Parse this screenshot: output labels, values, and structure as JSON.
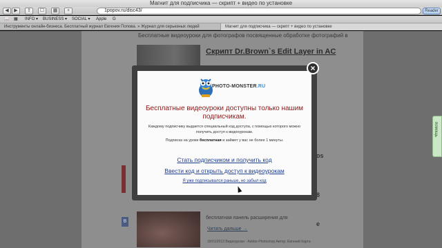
{
  "window": {
    "title": "Магнит для подписчика — скрипт + видео по установке"
  },
  "toolbar": {
    "back_icon": "back-arrow",
    "forward_icon": "forward-arrow",
    "share_icon": "share-icon",
    "bookmarks_icon": "book-icon",
    "history_icon": "grid-icon",
    "add_icon": "plus-icon",
    "url": "1popov.ru/disc43/",
    "reader_label": "Reader"
  },
  "bookmarks": {
    "items": [
      "INFO ▾",
      "BUSINESS ▾",
      "SOCIAL ▾",
      "Apple",
      "G"
    ]
  },
  "tabs": [
    {
      "label": "Инструменты онлайн-бизнеса. Бесплатный журнал Евгения Попова. » Журнал для серьезных людей"
    },
    {
      "label": "Магнит для подписчика — скрипт + видео по установке"
    }
  ],
  "page": {
    "subtitle": "Бесплатные видеоуроки  для фотографов посвященные обработке фотографий в",
    "headline": "Скрипт Dr.Brown`s Edit Layer in AC",
    "snippet": "бесплатная панель расширения для",
    "read_more": "Читать дальше →",
    "meta": "18/01/2013  Видеоуроки · Adobe Photoshop  Автор: Евгений Карта",
    "side_letters": [
      "os",
      "8",
      "e"
    ],
    "left_badge": "B"
  },
  "help_tab": {
    "label": "помощь"
  },
  "modal": {
    "logo_text": "PHOTO-MONSTER",
    "logo_suffix": ".RU",
    "title": "Бесплатные видеоуроки доступны только нашим подписчикам.",
    "description": "Каждому подписчику выдается специальный код доступа, с помощью которого можно получить доступ к видеоурокам.",
    "note_prefix": "Подписка на уроки",
    "note_bold": "бесплатная",
    "note_suffix": "и займет у вас не более 1 минуты.",
    "link_subscribe": "Стать подписчиком и получить код",
    "link_enter_code": "Ввести код и открыть доступ к видеоурокам",
    "link_forgot": "Я уже подписывался раньше, но забыл код",
    "close_label": "×"
  }
}
